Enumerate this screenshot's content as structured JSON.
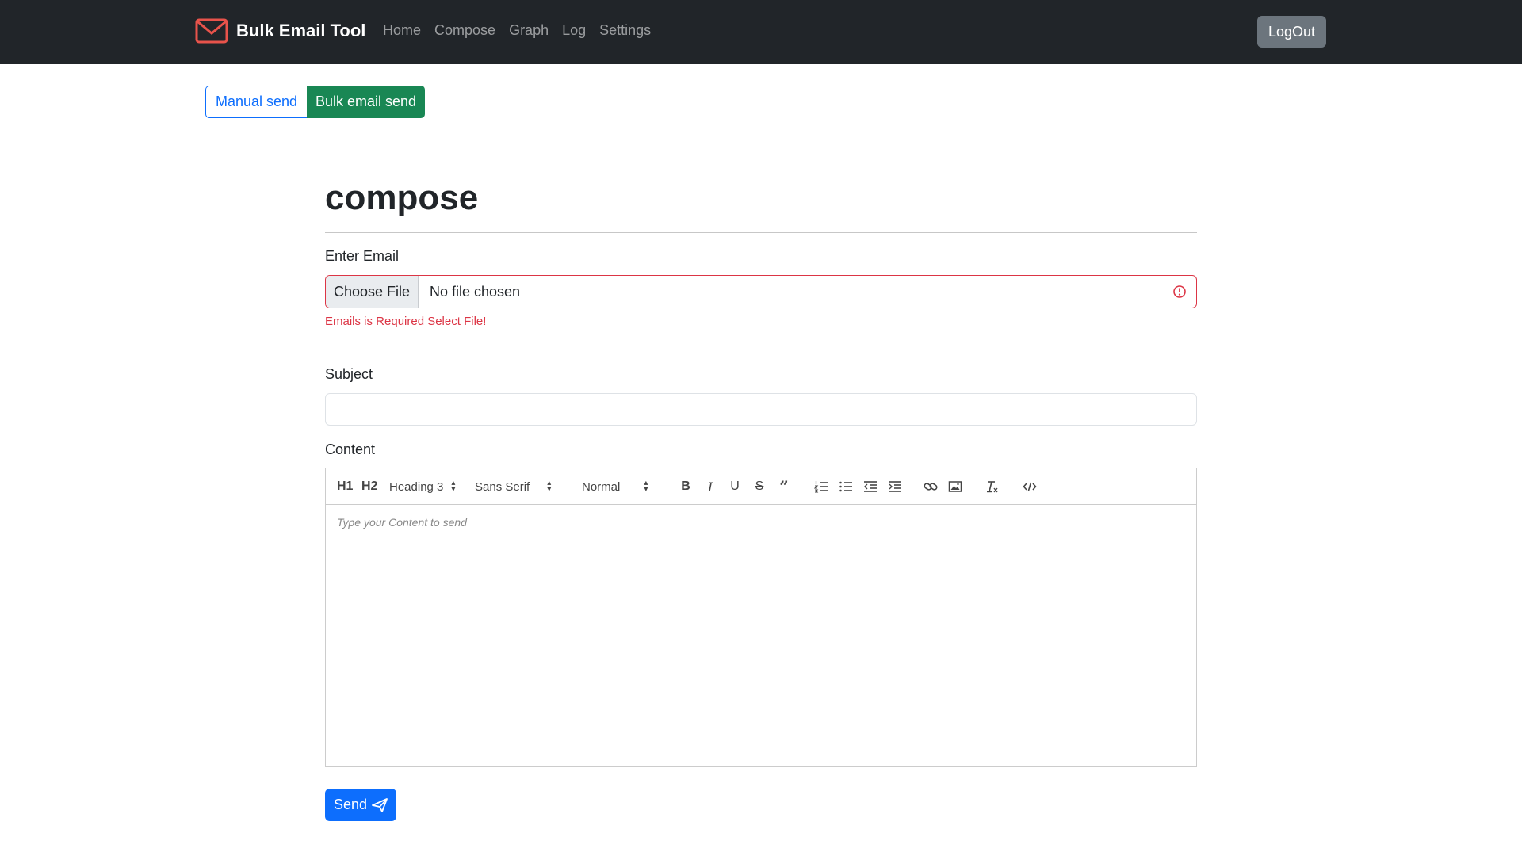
{
  "navbar": {
    "brand": "Bulk Email Tool",
    "links": [
      "Home",
      "Compose",
      "Graph",
      "Log",
      "Settings"
    ],
    "logout_label": "LogOut",
    "brand_icon_color": "#e8534b"
  },
  "mode_toggle": {
    "manual_label": "Manual send",
    "bulk_label": "Bulk email send",
    "active": "Bulk email send"
  },
  "form": {
    "title": "compose",
    "email_label": "Enter Email",
    "choose_file_label": "Choose File",
    "file_status": "No file chosen",
    "email_error": "Emails is Required Select File!",
    "subject_label": "Subject",
    "subject_value": "",
    "content_label": "Content",
    "content_placeholder": "Type your Content to send",
    "send_label": "Send"
  },
  "toolbar": {
    "h1": "H1",
    "h2": "H2",
    "header_select": "Heading 3",
    "font_select": "Sans Serif",
    "size_select": "Normal",
    "icons": [
      "bold-icon",
      "italic-icon",
      "underline-icon",
      "strike-icon",
      "blockquote-icon",
      "ordered-list-icon",
      "bullet-list-icon",
      "outdent-icon",
      "indent-icon",
      "link-icon",
      "image-icon",
      "clean-icon",
      "code-block-icon"
    ]
  },
  "colors": {
    "navbar_bg": "#212529",
    "primary": "#0d6efd",
    "success": "#198754",
    "danger": "#dc3545",
    "secondary": "#6c757d"
  }
}
